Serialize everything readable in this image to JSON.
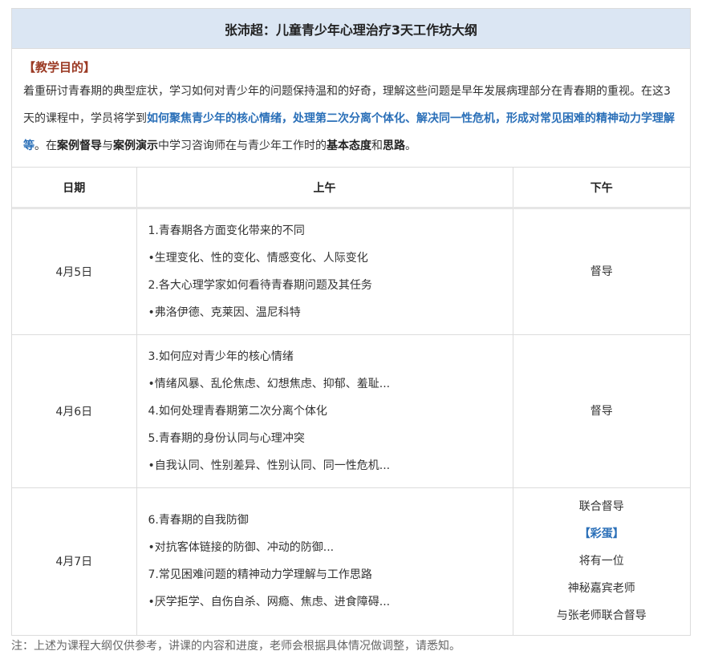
{
  "title": "张沛超：儿童青少年心理治疗3天工作坊大纲",
  "intro": {
    "heading": "【教学目的】",
    "text1": "着重研讨青春期的典型症状，学习如何对青少年的问题保持温和的好奇，理解这些问题是早年发展病理部分在青春期的重视。在这3天的课程中，学员将学到",
    "highlight1": "如何聚焦青少年的核心情绪，处理第二次分离个体化、解决同一性危机，形成对常见困难的精神动力学理解等",
    "text2": "。在",
    "bold1": "案例督导",
    "text3": "与",
    "bold2": "案例演示",
    "text4": "中学习咨询师在与青少年工作时的",
    "bold3": "基本态度",
    "text5": "和",
    "bold4": "思路",
    "text6": "。"
  },
  "table": {
    "headers": {
      "date": "日期",
      "am": "上午",
      "pm": "下午"
    },
    "rows": [
      {
        "date": "4月5日",
        "am": [
          "1.青春期各方面变化带来的不同",
          "•生理变化、性的变化、情感变化、人际变化",
          "2.各大心理学家如何看待青春期问题及其任务",
          "•弗洛伊德、克莱因、温尼科特"
        ],
        "pm": [
          "督导"
        ]
      },
      {
        "date": "4月6日",
        "am": [
          "3.如何应对青少年的核心情绪",
          "•情绪风暴、乱伦焦虑、幻想焦虑、抑郁、羞耻...",
          "4.如何处理青春期第二次分离个体化",
          "5.青春期的身份认同与心理冲突",
          "•自我认同、性别差异、性别认同、同一性危机..."
        ],
        "pm": [
          "督导"
        ]
      },
      {
        "date": "4月7日",
        "am": [
          "6.青春期的自我防御",
          "•对抗客体链接的防御、冲动的防御...",
          "7.常见困难问题的精神动力学理解与工作思路",
          "•厌学拒学、自伤自杀、网瘾、焦虑、进食障碍..."
        ],
        "pm": [
          "联合督导",
          "【彩蛋】",
          "将有一位",
          "神秘嘉宾老师",
          "与张老师联合督导"
        ]
      }
    ]
  },
  "note": "注：上述为课程大纲仅供参考，讲课的内容和进度，老师会根据具体情况做调整，请悉知。",
  "colors": {
    "header_bg": "#dbe6f3",
    "heading_red": "#9b3a24",
    "accent_blue": "#2a6fb8"
  }
}
